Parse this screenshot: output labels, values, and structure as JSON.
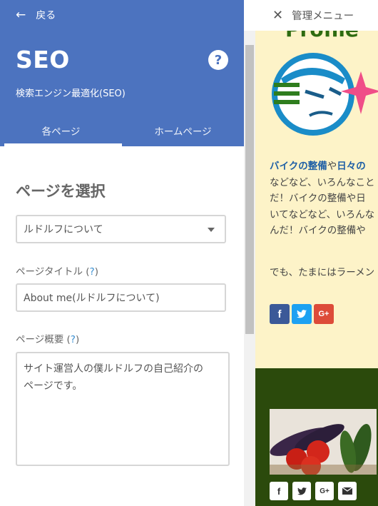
{
  "header": {
    "back_icon": "arrow-left-icon",
    "back_label": "戻る",
    "title": "SEO",
    "help_label": "?",
    "subtitle": "検索エンジン最適化(SEO)",
    "bg_color": "#4c73bf"
  },
  "tabs": [
    {
      "label": "各ページ",
      "active": true
    },
    {
      "label": "ホームページ",
      "active": false
    }
  ],
  "form": {
    "select_heading": "ページを選択",
    "page_select_value": "ルドルフについて",
    "title_label": "ページタイトル",
    "title_value": "About me(ルドルフについて)",
    "desc_label": "ページ概要",
    "desc_value": "サイト運営人の僕ルドルフの自己紹介の\nページです。",
    "help_mark": "?"
  },
  "preview": {
    "admin_close_icon": "close-icon",
    "admin_menu_label": "管理メニュー",
    "profile_heading": "Profile",
    "blurb": {
      "hl1": "バイクの整備",
      "mid": "や",
      "hl2": "日々の",
      "line2": "などなど、いろんなこと",
      "line3": "だ！バイクの整備や日",
      "line4": "いてなどなど、いろんな",
      "line5": "んだ！バイクの整備や"
    },
    "blurb2": "でも、たまにはラーメン",
    "social": [
      "f",
      "t",
      "G+"
    ],
    "footer_social": [
      "f",
      "t",
      "G+",
      "mail"
    ],
    "colors": {
      "bg": "#fdf3c8",
      "footer": "#2b4a0c"
    }
  }
}
